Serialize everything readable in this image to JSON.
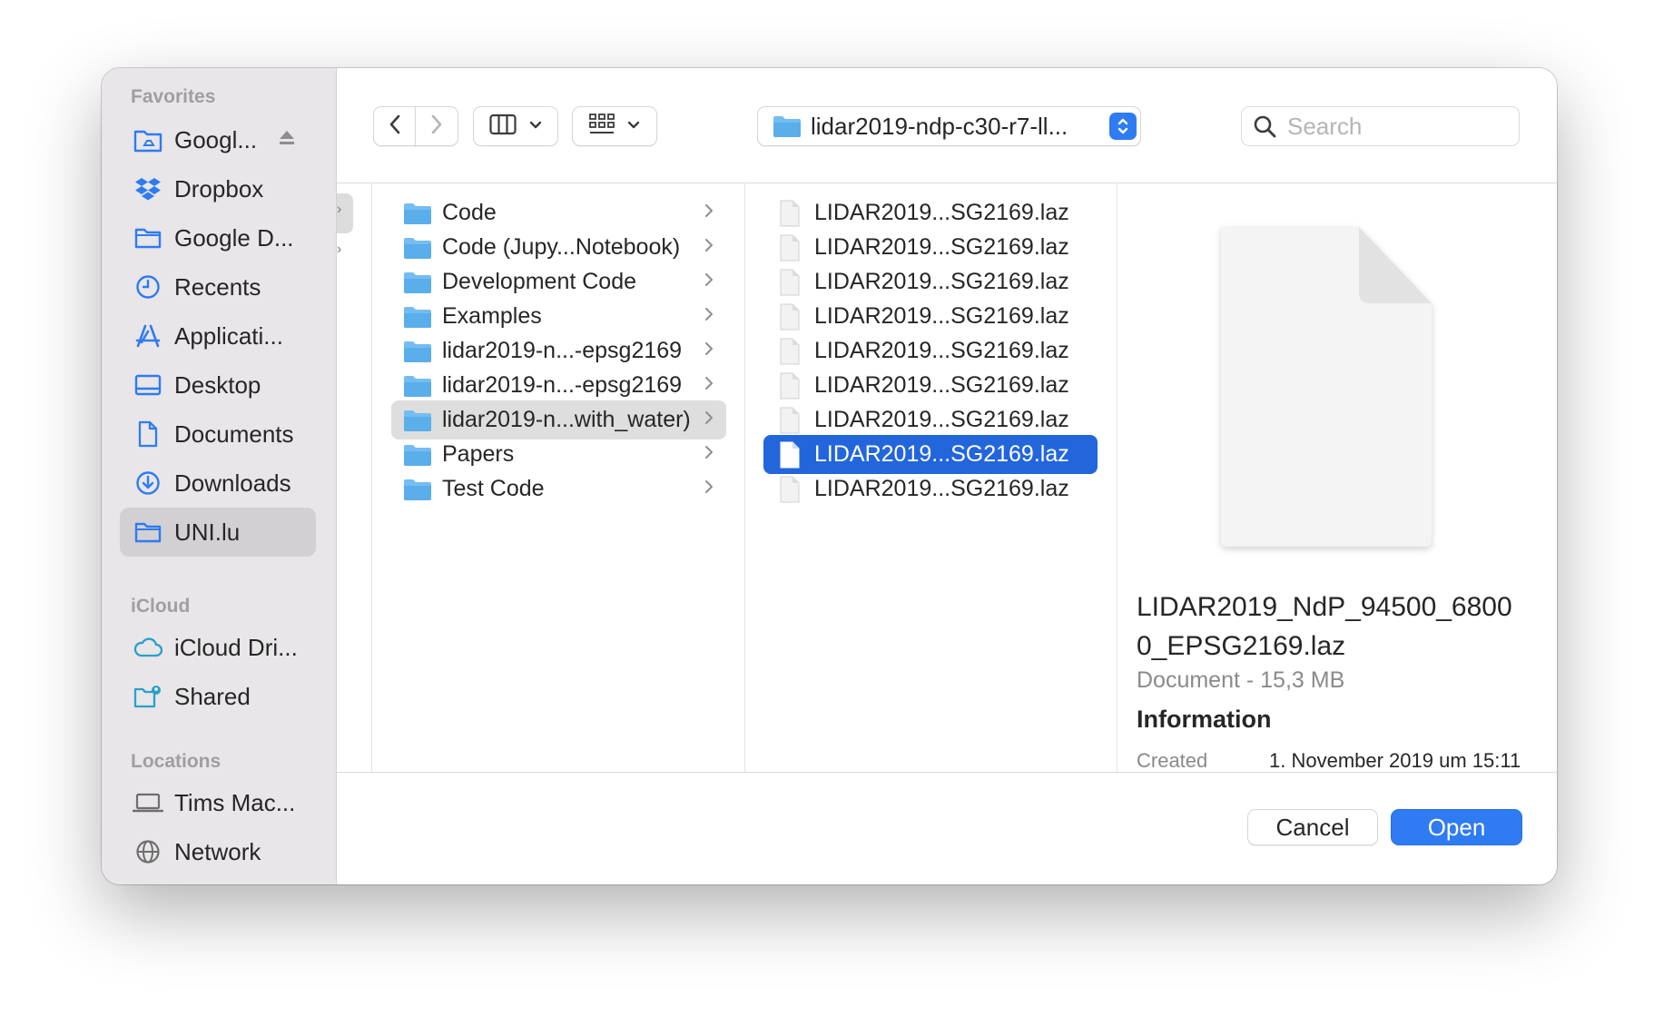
{
  "sidebar": {
    "favorites_title": "Favorites",
    "icloud_title": "iCloud",
    "locations_title": "Locations",
    "favorites": [
      {
        "label": "Googl...",
        "icon": "google-drive-icon"
      },
      {
        "label": "Dropbox",
        "icon": "dropbox-icon"
      },
      {
        "label": "Google D...",
        "icon": "folder-icon"
      },
      {
        "label": "Recents",
        "icon": "clock-icon"
      },
      {
        "label": "Applicati...",
        "icon": "applications-icon"
      },
      {
        "label": "Desktop",
        "icon": "desktop-icon"
      },
      {
        "label": "Documents",
        "icon": "document-icon"
      },
      {
        "label": "Downloads",
        "icon": "downloads-icon"
      },
      {
        "label": "UNI.lu",
        "icon": "folder-icon",
        "selected": true
      }
    ],
    "icloud": [
      {
        "label": "iCloud Dri...",
        "icon": "cloud-icon"
      },
      {
        "label": "Shared",
        "icon": "shared-folder-icon"
      }
    ],
    "locations": [
      {
        "label": "Tims Mac...",
        "icon": "laptop-icon"
      },
      {
        "label": "Network",
        "icon": "globe-icon"
      }
    ]
  },
  "toolbar": {
    "path_label": "lidar2019-ndp-c30-r7-ll...",
    "search_placeholder": "Search"
  },
  "column1": [
    "Code",
    "Code (Jupy...Notebook)",
    "Development Code",
    "Examples",
    "lidar2019-n...-epsg2169",
    "lidar2019-n...-epsg2169",
    "lidar2019-n...with_water)",
    "Papers",
    "Test Code"
  ],
  "column1_selected_index": 6,
  "column2": [
    "LIDAR2019...SG2169.laz",
    "LIDAR2019...SG2169.laz",
    "LIDAR2019...SG2169.laz",
    "LIDAR2019...SG2169.laz",
    "LIDAR2019...SG2169.laz",
    "LIDAR2019...SG2169.laz",
    "LIDAR2019...SG2169.laz",
    "LIDAR2019...SG2169.laz",
    "LIDAR2019...SG2169.laz"
  ],
  "column2_selected_index": 7,
  "preview": {
    "filename": "LIDAR2019_NdP_94500_68000_EPSG2169.laz",
    "kind": "Document - 15,3 MB",
    "info_title": "Information",
    "created_label": "Created",
    "created_value": "1. November 2019 um 15:11"
  },
  "footer": {
    "cancel_label": "Cancel",
    "open_label": "Open"
  },
  "colors": {
    "accent": "#2f7bf2",
    "selection": "#2366dc",
    "sidebar_icon": "#2f7bf2",
    "folder": "#5fb4f0"
  }
}
